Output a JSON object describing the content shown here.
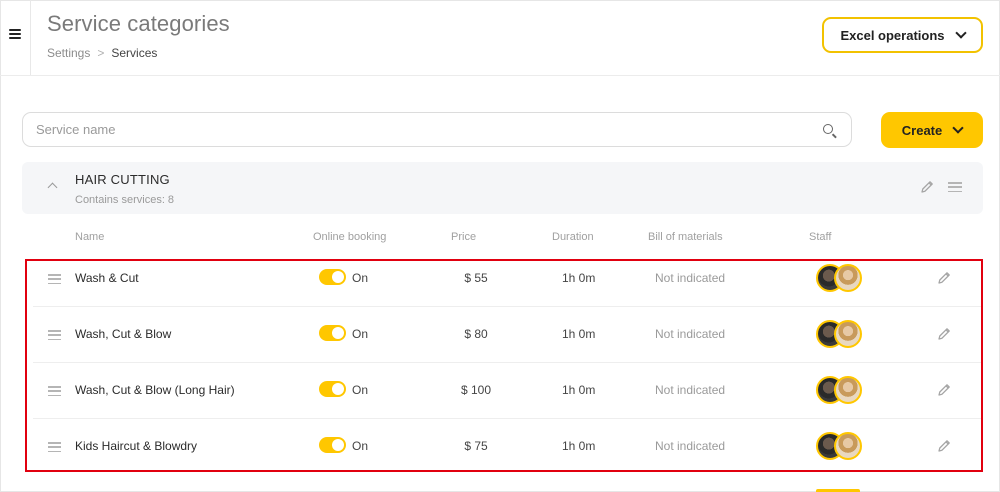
{
  "header": {
    "title": "Service categories",
    "breadcrumb": {
      "parent": "Settings",
      "separator": ">",
      "current": "Services"
    },
    "excel_button": "Excel operations"
  },
  "search": {
    "placeholder": "Service name",
    "value": ""
  },
  "create_button": "Create",
  "category": {
    "name": "HAIR CUTTING",
    "count_text": "Contains services: 8"
  },
  "columns": {
    "name": "Name",
    "online_booking": "Online booking",
    "price": "Price",
    "duration": "Duration",
    "bill_of_materials": "Bill of materials",
    "staff": "Staff"
  },
  "services": [
    {
      "name": "Wash & Cut",
      "online": "On",
      "price": "$ 55",
      "duration": "1h 0m",
      "bom": "Not indicated"
    },
    {
      "name": "Wash, Cut & Blow",
      "online": "On",
      "price": "$ 80",
      "duration": "1h 0m",
      "bom": "Not indicated"
    },
    {
      "name": "Wash, Cut & Blow (Long Hair)",
      "online": "On",
      "price": "$ 100",
      "duration": "1h 0m",
      "bom": "Not indicated"
    },
    {
      "name": "Kids Haircut & Blowdry",
      "online": "On",
      "price": "$ 75",
      "duration": "1h 0m",
      "bom": "Not indicated"
    }
  ],
  "colors": {
    "accent": "#ffc700",
    "highlight_border": "#e1000f"
  },
  "icons": [
    "menu-icon",
    "chevron-down-icon",
    "search-icon",
    "chevron-up-icon",
    "pencil-icon",
    "drag-handle-icon"
  ]
}
